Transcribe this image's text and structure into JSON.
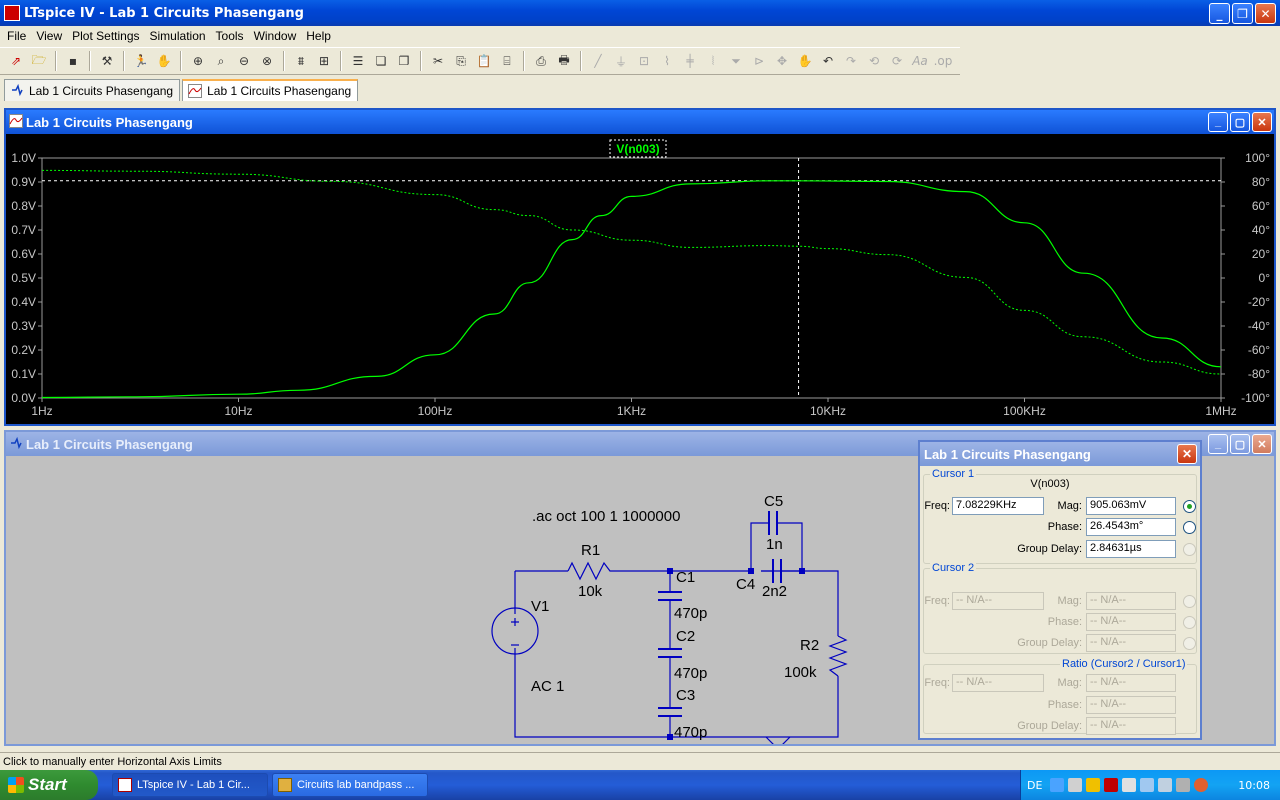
{
  "window": {
    "title": "LTspice IV - Lab 1 Circuits Phasengang"
  },
  "menu": [
    "File",
    "View",
    "Plot Settings",
    "Simulation",
    "Tools",
    "Window",
    "Help"
  ],
  "tabs": [
    {
      "label": "Lab 1 Circuits Phasengang"
    },
    {
      "label": "Lab 1 Circuits Phasengang"
    }
  ],
  "plot_pane": {
    "title": "Lab 1 Circuits Phasengang",
    "trace_label": "V(n003)"
  },
  "chart_data": {
    "type": "line",
    "xscale": "log",
    "x_ticks": [
      "1Hz",
      "10Hz",
      "100Hz",
      "1KHz",
      "10KHz",
      "100KHz",
      "1MHz"
    ],
    "x_tick_values": [
      1,
      10,
      100,
      1000,
      10000,
      100000,
      1000000
    ],
    "xlim": [
      1,
      1000000
    ],
    "y_left_ticks": [
      "1.0V",
      "0.9V",
      "0.8V",
      "0.7V",
      "0.6V",
      "0.5V",
      "0.4V",
      "0.3V",
      "0.2V",
      "0.1V",
      "0.0V"
    ],
    "y_right_ticks": [
      "100°",
      "80°",
      "60°",
      "40°",
      "20°",
      "0°",
      "-20°",
      "-40°",
      "-60°",
      "-80°",
      "-100°"
    ],
    "ylim_left": [
      0,
      1.0
    ],
    "ylim_right": [
      -100,
      100
    ],
    "series": [
      {
        "name": "V(n003)",
        "style": "solid",
        "axis": "left",
        "x": [
          1,
          3,
          10,
          20,
          50,
          100,
          200,
          300,
          500,
          700,
          1000,
          2000,
          5000,
          7082,
          20000,
          50000,
          100000,
          200000,
          500000,
          1000000
        ],
        "values": [
          0.002,
          0.005,
          0.016,
          0.032,
          0.09,
          0.18,
          0.35,
          0.48,
          0.66,
          0.76,
          0.84,
          0.892,
          0.905,
          0.905,
          0.902,
          0.86,
          0.73,
          0.52,
          0.25,
          0.13
        ]
      },
      {
        "name": "V(n003)",
        "style": "dotted",
        "axis": "right",
        "x": [
          1,
          3,
          10,
          30,
          100,
          200,
          300,
          500,
          1000,
          2000,
          5000,
          7082,
          10000,
          20000,
          50000,
          100000,
          200000,
          500000,
          1000000
        ],
        "values": [
          89.7,
          89,
          86.5,
          80.5,
          69.5,
          57,
          52,
          40,
          31.5,
          25.5,
          27,
          26.5,
          24.5,
          19.5,
          0.5,
          -27,
          -49,
          -70,
          -80
        ]
      }
    ],
    "cursor": {
      "x": 7082.29,
      "y": 0.905
    },
    "grid": false
  },
  "schematic_pane": {
    "title": "Lab 1 Circuits Phasengang"
  },
  "schematic": {
    "directive": ".ac oct 100 1 1000000",
    "labels": {
      "R1": "R1",
      "R1v": "10k",
      "C1": "C1",
      "C1v": "470p",
      "C2": "C2",
      "C2v": "470p",
      "C3": "C3",
      "C3v": "470p",
      "C4": "C4",
      "C4v": "2n2",
      "C5": "C5",
      "C5v": "1n",
      "R2": "R2",
      "R2v": "100k",
      "V1": "V1",
      "V1v": "AC 1"
    }
  },
  "cursor_dialog": {
    "title": "Lab 1 Circuits Phasengang",
    "cursor1": {
      "group": "Cursor 1",
      "trace": "V(n003)",
      "freq_label": "Freq:",
      "freq": "7.08229KHz",
      "mag_label": "Mag:",
      "mag": "905.063mV",
      "phase_label": "Phase:",
      "phase": "26.4543m°",
      "gd_label": "Group Delay:",
      "gd": "2.84631µs"
    },
    "cursor2": {
      "group": "Cursor 2",
      "freq_label": "Freq:",
      "freq": "-- N/A--",
      "mag_label": "Mag:",
      "mag": "-- N/A--",
      "phase_label": "Phase:",
      "phase": "-- N/A--",
      "gd_label": "Group Delay:",
      "gd": "-- N/A--"
    },
    "ratio": {
      "group": "Ratio (Cursor2 / Cursor1)",
      "freq_label": "Freq:",
      "freq": "-- N/A--",
      "mag_label": "Mag:",
      "mag": "-- N/A--",
      "phase_label": "Phase:",
      "phase": "-- N/A--",
      "gd_label": "Group Delay:",
      "gd": "-- N/A--"
    }
  },
  "status": {
    "text": "Click to manually enter Horizontal Axis Limits"
  },
  "taskbar": {
    "start": "Start",
    "tasks": [
      {
        "label": "LTspice IV - Lab 1 Cir..."
      },
      {
        "label": "Circuits lab bandpass ..."
      }
    ],
    "lang": "DE",
    "clock": "10:08"
  }
}
